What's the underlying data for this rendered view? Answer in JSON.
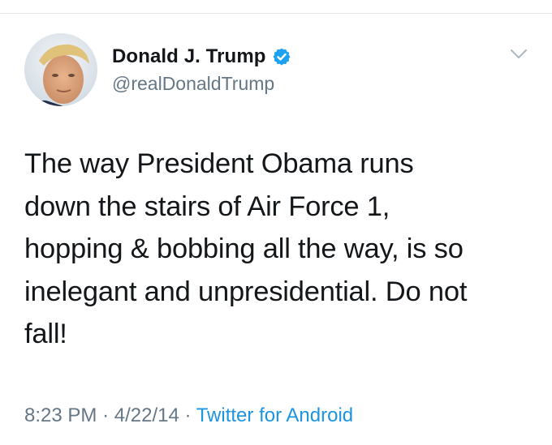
{
  "tweet": {
    "author": {
      "display_name": "Donald J. Trump",
      "handle": "@realDonaldTrump",
      "verified": true,
      "avatar_icon": "profile-photo"
    },
    "text": "The way President Obama runs\ndown the stairs of Air Force 1,\nhopping & bobbing all the way, is so\ninelegant and unpresidential. Do not\nfall!",
    "time": "8:23 PM",
    "separator": "·",
    "date": "4/22/14",
    "source": "Twitter for Android",
    "menu_icon": "chevron-down-icon"
  },
  "colors": {
    "text_primary": "#14171a",
    "text_secondary": "#657786",
    "link": "#1b95e0",
    "verified_badge": "#1da1f2"
  }
}
